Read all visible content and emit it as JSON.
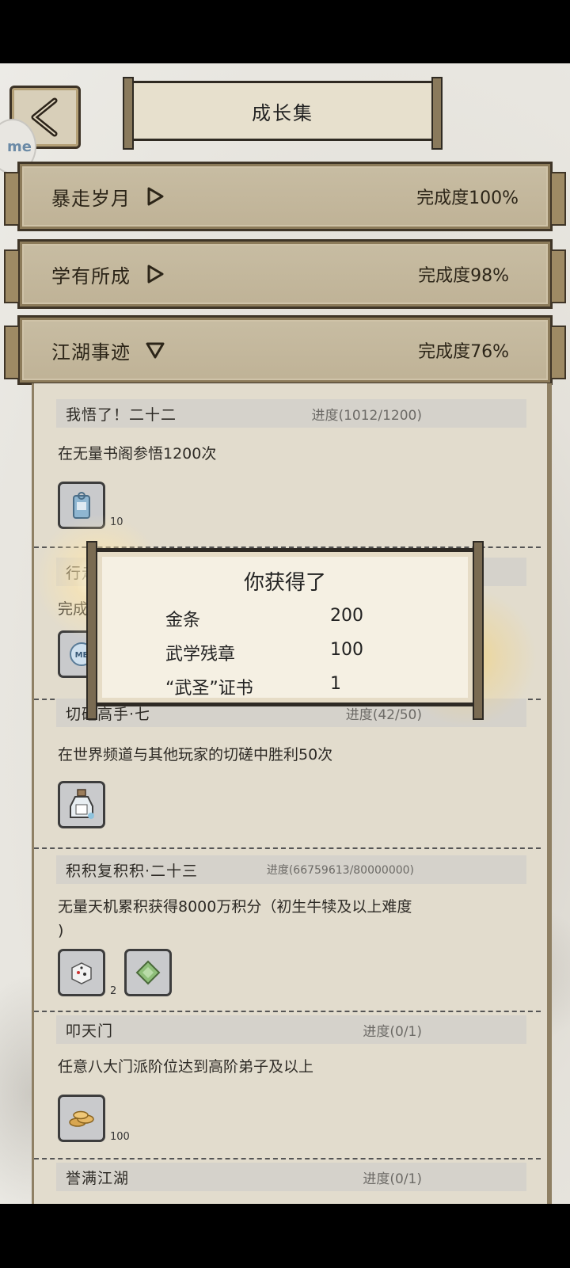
{
  "header": {
    "title": "成长集",
    "back_icon": "back-arrow-icon",
    "corner_chip": "me"
  },
  "categories": [
    {
      "name": "暴走岁月",
      "arrow": "triangle-right-icon",
      "completion": "完成度100%"
    },
    {
      "name": "学有所成",
      "arrow": "triangle-right-icon",
      "completion": "完成度98%"
    },
    {
      "name": "江湖事迹",
      "arrow": "triangle-down-icon",
      "completion": "完成度76%"
    }
  ],
  "tasks": [
    {
      "name": "我悟了！二十二",
      "progress": "进度(1012/1200)",
      "desc": "在无量书阁参悟1200次",
      "items": [
        {
          "icon": "scroll-tag-icon",
          "count": "10"
        }
      ]
    },
    {
      "name": "行走",
      "progress": "",
      "desc": "完成",
      "items": [
        {
          "icon": "me-token-icon",
          "count": ""
        }
      ]
    },
    {
      "name": "切磋高手·七",
      "progress": "进度(42/50)",
      "desc": "在世界频道与其他玩家的切磋中胜利50次",
      "items": [
        {
          "icon": "potion-bottle-icon",
          "count": ""
        }
      ]
    },
    {
      "name": "积积复积积·二十三",
      "progress": "进度(66759613/80000000)",
      "desc": "无量天机累积获得8000万积分（初生牛犊及以上难度",
      "desc2": ")",
      "items": [
        {
          "icon": "dice-icon",
          "count": "2"
        },
        {
          "icon": "jade-token-icon",
          "count": ""
        }
      ]
    },
    {
      "name": "叩天门",
      "progress": "进度(0/1)",
      "desc": "任意八大门派阶位达到高阶弟子及以上",
      "items": [
        {
          "icon": "gold-coins-icon",
          "count": "100"
        }
      ]
    },
    {
      "name": "誉满江湖",
      "progress": "进度(0/1)"
    }
  ],
  "reward_popup": {
    "title": "你获得了",
    "rows": [
      {
        "name": "金条",
        "qty": "200"
      },
      {
        "name": "武学残章",
        "qty": "100"
      },
      {
        "name": "“武圣”证书",
        "qty": "1"
      }
    ]
  },
  "colors": {
    "bar": "#c8bda3",
    "panel": "#e2dccd",
    "popup": "#f5f0e3",
    "sparkle": "#f3d27a"
  }
}
